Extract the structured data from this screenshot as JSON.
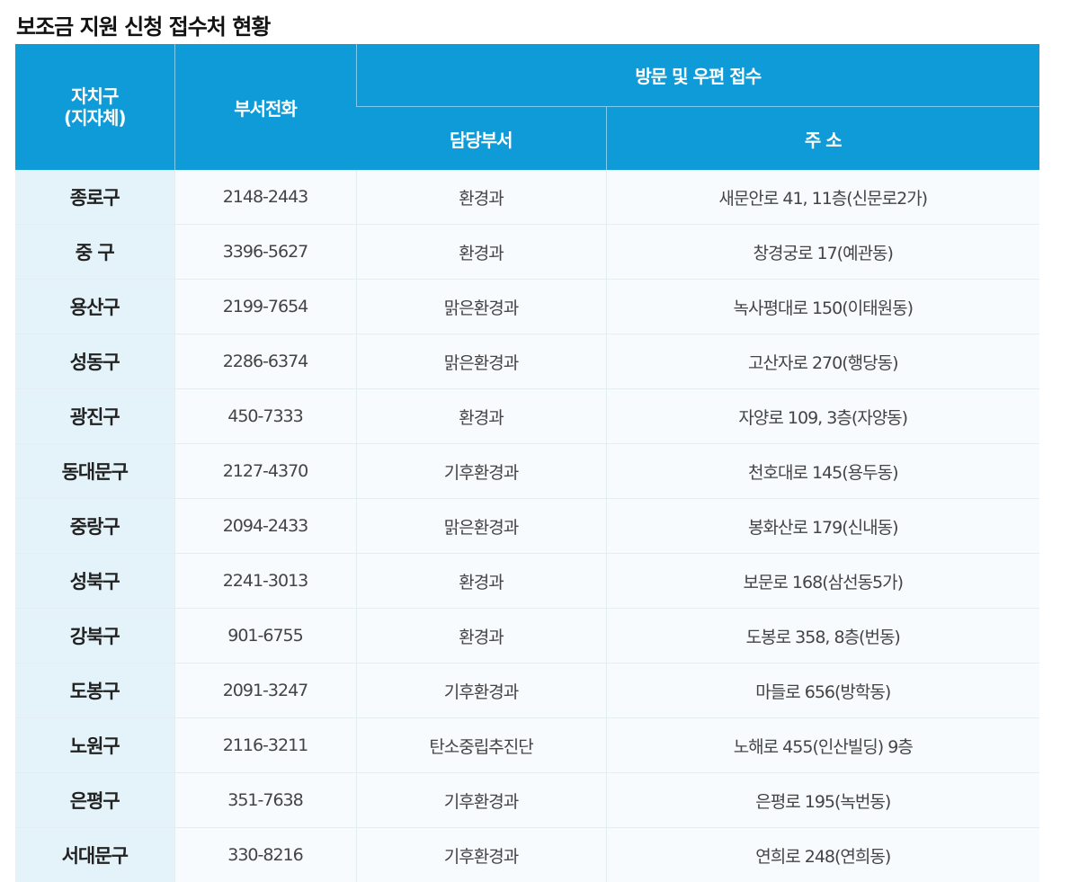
{
  "page": {
    "title": "보조금 지원 신청 접수처 현황"
  },
  "table": {
    "headers": {
      "district_line1": "자치구",
      "district_line2": "(지자체)",
      "phone": "부서전화",
      "group": "방문 및 우편 접수",
      "department": "담당부서",
      "address": "주 소"
    },
    "rows": [
      {
        "district": "종로구",
        "phone": "2148-2443",
        "department": "환경과",
        "address": "새문안로 41, 11층(신문로2가)"
      },
      {
        "district": "중 구",
        "phone": "3396-5627",
        "department": "환경과",
        "address": "창경궁로 17(예관동)"
      },
      {
        "district": "용산구",
        "phone": "2199-7654",
        "department": "맑은환경과",
        "address": "녹사평대로 150(이태원동)"
      },
      {
        "district": "성동구",
        "phone": "2286-6374",
        "department": "맑은환경과",
        "address": "고산자로 270(행당동)"
      },
      {
        "district": "광진구",
        "phone": "450-7333",
        "department": "환경과",
        "address": "자양로 109, 3층(자양동)"
      },
      {
        "district": "동대문구",
        "phone": "2127-4370",
        "department": "기후환경과",
        "address": "천호대로 145(용두동)"
      },
      {
        "district": "중랑구",
        "phone": "2094-2433",
        "department": "맑은환경과",
        "address": "봉화산로 179(신내동)"
      },
      {
        "district": "성북구",
        "phone": "2241-3013",
        "department": "환경과",
        "address": "보문로 168(삼선동5가)"
      },
      {
        "district": "강북구",
        "phone": "901-6755",
        "department": "환경과",
        "address": "도봉로 358, 8층(번동)"
      },
      {
        "district": "도봉구",
        "phone": "2091-3247",
        "department": "기후환경과",
        "address": "마들로 656(방학동)"
      },
      {
        "district": "노원구",
        "phone": "2116-3211",
        "department": "탄소중립추진단",
        "address": "노해로 455(인산빌딩) 9층"
      },
      {
        "district": "은평구",
        "phone": "351-7638",
        "department": "기후환경과",
        "address": "은평로 195(녹번동)"
      },
      {
        "district": "서대문구",
        "phone": "330-8216",
        "department": "기후환경과",
        "address": "연희로 248(연희동)"
      }
    ]
  },
  "colors": {
    "header_bg": "#0e9bd8",
    "district_bg": "#e4f3fa",
    "row_bg": "#f7fbfd"
  }
}
